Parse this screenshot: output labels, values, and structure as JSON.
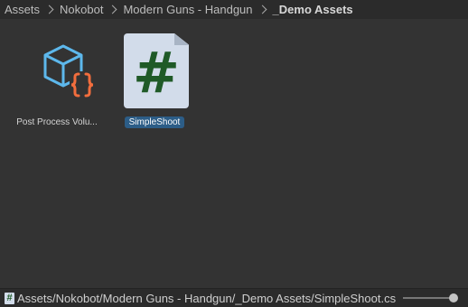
{
  "breadcrumb": {
    "items": [
      "Assets",
      "Nokobot",
      "Modern Guns - Handgun",
      "_Demo Assets"
    ]
  },
  "assets": [
    {
      "label": "Post Process Volu...",
      "icon": "post-process-volume-icon",
      "selected": false
    },
    {
      "label": "SimpleShoot",
      "icon": "csharp-script-icon",
      "glyph": "#",
      "selected": true
    }
  ],
  "statusbar": {
    "icon": "csharp-script-icon",
    "icon_glyph": "#",
    "path": "Assets/Nokobot/Modern Guns - Handgun/_Demo Assets/SimpleShoot.cs",
    "zoom_fraction": 1.0
  },
  "colors": {
    "selection": "#2c5d87",
    "cube": "#5db8ec",
    "braces": "#f26d3d",
    "script_bg": "#d2dcea",
    "script_hash": "#1f5a27"
  }
}
